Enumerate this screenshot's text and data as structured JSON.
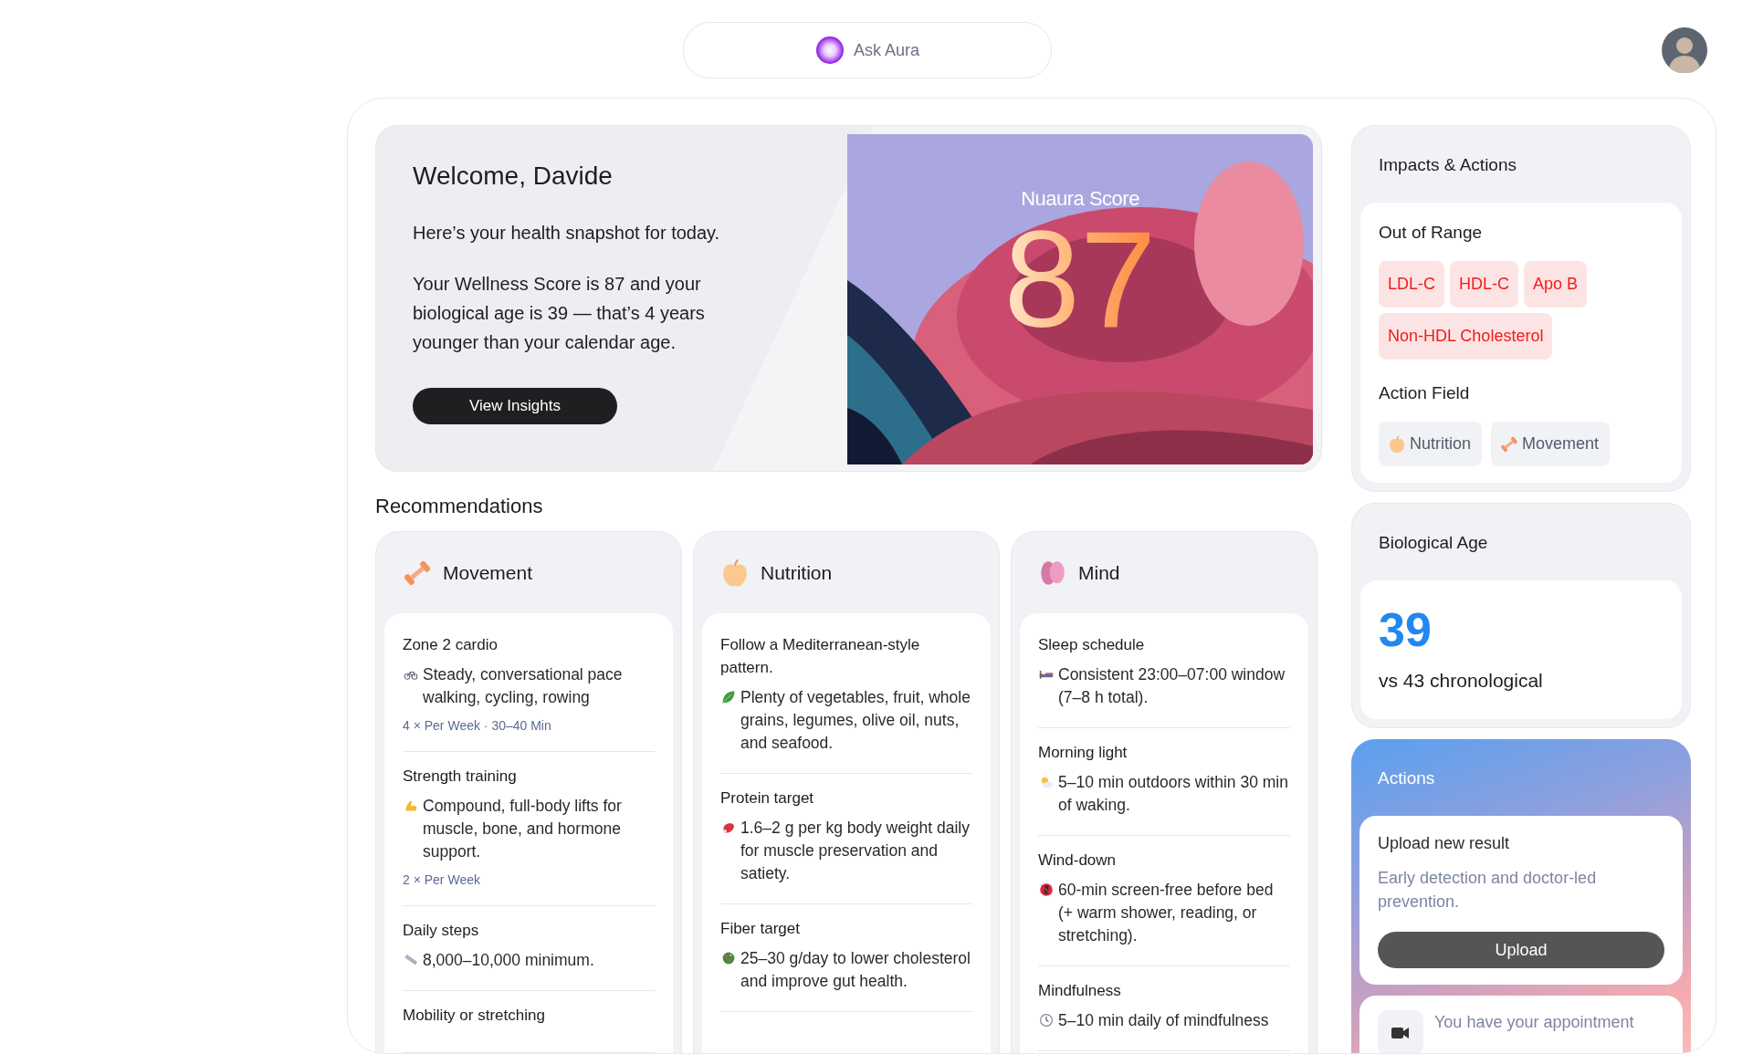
{
  "ask_bar": {
    "label": "Ask Aura"
  },
  "hero": {
    "title": "Welcome, Davide",
    "intro": "Here’s your health snapshot for today.",
    "summary": "Your Wellness Score is 87 and your biological age is 39 — that’s 4 years younger than your calendar age.",
    "button": "View Insights",
    "score_label": "Nuaura Score",
    "score": "87"
  },
  "recommendations": {
    "title": "Recommendations",
    "columns": [
      {
        "title": "Movement",
        "items": [
          {
            "title": "Zone 2 cardio",
            "text": "Steady, conversational pace walking, cycling, rowing",
            "frequency": "4 × Per Week · 30–40 Min"
          },
          {
            "title": "Strength training",
            "text": "Compound, full-body lifts for muscle, bone, and hormone support.",
            "frequency": "2 × Per Week"
          },
          {
            "title": "Daily steps",
            "text": "8,000–10,000 minimum."
          },
          {
            "title": "Mobility or stretching"
          }
        ]
      },
      {
        "title": "Nutrition",
        "items": [
          {
            "title": "Follow a Mediterranean-style pattern.",
            "text": "Plenty of vegetables, fruit, whole grains, legumes, olive oil, nuts, and seafood."
          },
          {
            "title": "Protein target",
            "text": "1.6–2 g per kg body weight daily for muscle preservation and satiety."
          },
          {
            "title": "Fiber target",
            "text": "25–30 g/day to lower cholesterol and improve gut health."
          }
        ]
      },
      {
        "title": "Mind",
        "items": [
          {
            "title": "Sleep schedule",
            "text": "Consistent 23:00–07:00 window (7–8 h total)."
          },
          {
            "title": "Morning light",
            "text": "5–10 min outdoors within 30 min of waking."
          },
          {
            "title": "Wind-down",
            "text": "60-min screen-free before bed (+ warm shower, reading, or stretching)."
          },
          {
            "title": "Mindfulness",
            "text": "5–10 min daily of mindfulness"
          }
        ]
      }
    ]
  },
  "impacts": {
    "title": "Impacts & Actions",
    "out_of_range": {
      "title": "Out of Range",
      "tags": [
        "LDL-C",
        "HDL-C",
        "Apo B",
        "Non-HDL Cholesterol"
      ]
    },
    "action_field": {
      "title": "Action Field",
      "chips": [
        "Nutrition",
        "Movement"
      ]
    }
  },
  "biological_age": {
    "title": "Biological Age",
    "value": "39",
    "comparison": "vs 43 chronological"
  },
  "actions": {
    "title": "Actions",
    "upload": {
      "title": "Upload new result",
      "text": "Early detection and doctor-led prevention.",
      "button": "Upload"
    },
    "appointment": {
      "text": "You have your appointment"
    }
  }
}
